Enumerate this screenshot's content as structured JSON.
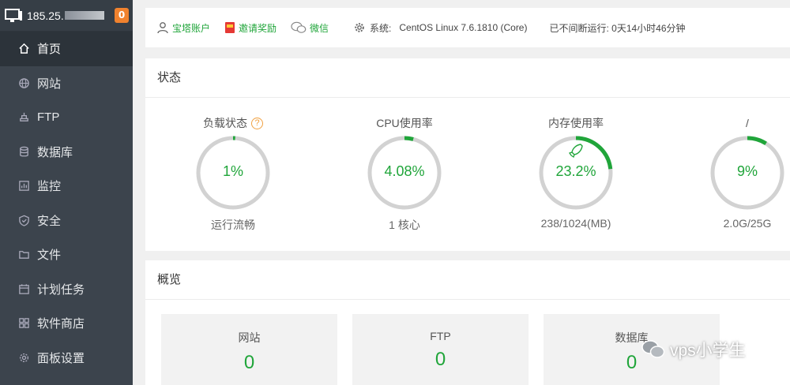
{
  "sidebar": {
    "server_ip": "185.25.",
    "notify_count": "0",
    "items": [
      {
        "label": "首页",
        "icon": "home-icon",
        "active": true
      },
      {
        "label": "网站",
        "icon": "globe-icon"
      },
      {
        "label": "FTP",
        "icon": "ftp-icon"
      },
      {
        "label": "数据库",
        "icon": "database-icon"
      },
      {
        "label": "监控",
        "icon": "monitor-chart-icon"
      },
      {
        "label": "安全",
        "icon": "shield-icon"
      },
      {
        "label": "文件",
        "icon": "folder-icon"
      },
      {
        "label": "计划任务",
        "icon": "calendar-icon"
      },
      {
        "label": "软件商店",
        "icon": "apps-grid-icon"
      },
      {
        "label": "面板设置",
        "icon": "gear-icon"
      }
    ]
  },
  "topbar": {
    "account": "宝塔账户",
    "invite": "邀请奖励",
    "wechat": "微信",
    "system_label": "系统:",
    "system_value": "CentOS Linux 7.6.1810 (Core)",
    "uptime": "已不间断运行: 0天14小时46分钟"
  },
  "status": {
    "title": "状态",
    "gauges": [
      {
        "title": "负载状态",
        "value": "1%",
        "percent": 1,
        "sub": "运行流畅",
        "help": "?"
      },
      {
        "title": "CPU使用率",
        "value": "4.08%",
        "percent": 4.08,
        "sub": "1 核心"
      },
      {
        "title": "内存使用率",
        "value": "23.2%",
        "percent": 23.2,
        "sub": "238/1024(MB)"
      },
      {
        "title": "/",
        "value": "9%",
        "percent": 9,
        "sub": "2.0G/25G"
      }
    ]
  },
  "overview": {
    "title": "概览",
    "boxes": [
      {
        "label": "网站",
        "count": "0"
      },
      {
        "label": "FTP",
        "count": "0"
      },
      {
        "label": "数据库",
        "count": "0"
      }
    ]
  },
  "watermark": "vps小学生",
  "colors": {
    "accent": "#20a53a",
    "sidebar": "#3c444d",
    "badge": "#f0822e",
    "ring_track": "#d2d2d2"
  }
}
